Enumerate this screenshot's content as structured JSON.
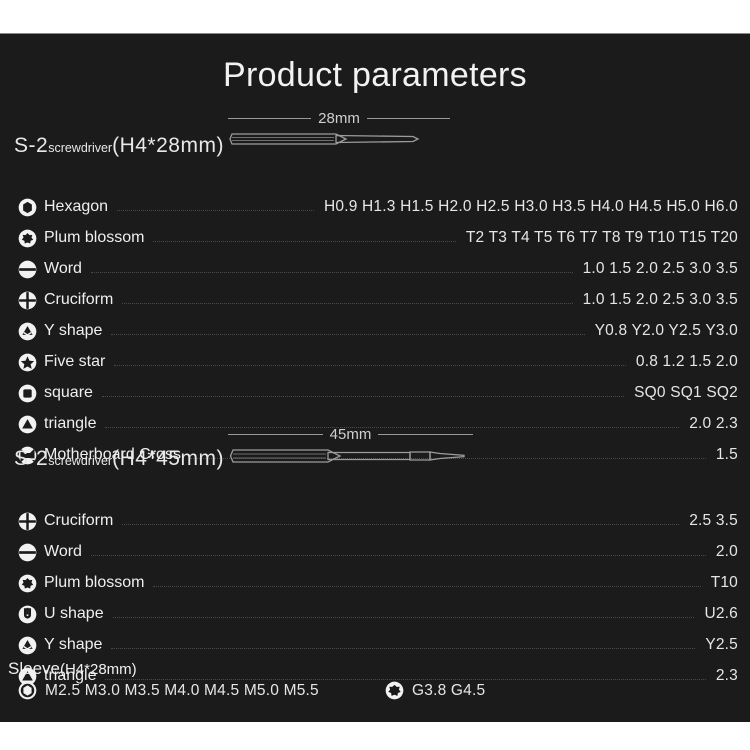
{
  "page": {
    "title": "Product parameters",
    "background_color": "#1b1b1b",
    "text_color": "#efefef",
    "outer_color": "#ffffff"
  },
  "sections": [
    {
      "id": "s2-28mm",
      "header_main": "S-2",
      "header_sub": "screwdriver",
      "header_spec": "(H4*28mm)",
      "dimension": "28mm",
      "rows": [
        {
          "icon": "hexagon-icon",
          "label": "Hexagon",
          "values": "H0.9  H1.3  H1.5  H2.0  H2.5  H3.0  H3.5  H4.0  H4.5  H5.0  H6.0"
        },
        {
          "icon": "plum-blossom-icon",
          "label": "Plum blossom",
          "values": "T2  T3  T4  T5  T6  T7  T8  T9  T10  T15  T20"
        },
        {
          "icon": "word-slot-icon",
          "label": "Word",
          "values": "1.0  1.5  2.0  2.5  3.0  3.5"
        },
        {
          "icon": "cruciform-icon",
          "label": "Cruciform",
          "values": "1.0  1.5  2.0  2.5  3.0  3.5"
        },
        {
          "icon": "y-shape-icon",
          "label": "Y shape",
          "values": "Y0.8  Y2.0  Y2.5  Y3.0"
        },
        {
          "icon": "five-star-icon",
          "label": "Five star",
          "values": "0.8  1.2  1.5  2.0"
        },
        {
          "icon": "square-icon",
          "label": "square",
          "values": "SQ0  SQ1  SQ2"
        },
        {
          "icon": "triangle-icon",
          "label": "triangle",
          "values": "2.0  2.3"
        },
        {
          "icon": "motherboard-cross-icon",
          "label": "Motherboard Cross",
          "values": "1.5"
        }
      ]
    },
    {
      "id": "s2-45mm",
      "header_main": "S-2",
      "header_sub": "screwdriver",
      "header_spec": "(H4*45mm)",
      "dimension": "45mm",
      "rows": [
        {
          "icon": "cruciform-icon",
          "label": "Cruciform",
          "values": "2.5  3.5"
        },
        {
          "icon": "word-slot-icon",
          "label": "Word",
          "values": "2.0"
        },
        {
          "icon": "plum-blossom-icon",
          "label": "Plum blossom",
          "values": "T10"
        },
        {
          "icon": "u-shape-icon",
          "label": "U shape",
          "values": "U2.6"
        },
        {
          "icon": "y-shape-icon",
          "label": "Y shape",
          "values": "Y2.5"
        },
        {
          "icon": "triangle-icon",
          "label": "triangle",
          "values": "2.3"
        }
      ]
    }
  ],
  "sleeve": {
    "header_main": "Sleeve",
    "header_spec": "(H4*28mm)",
    "groups": [
      {
        "icon": "socket-hex-icon",
        "values": "M2.5  M3.0  M3.5  M4.0  M4.5  M5.0  M5.5"
      },
      {
        "icon": "g-torx-icon",
        "values": "G3.8  G4.5"
      }
    ]
  }
}
